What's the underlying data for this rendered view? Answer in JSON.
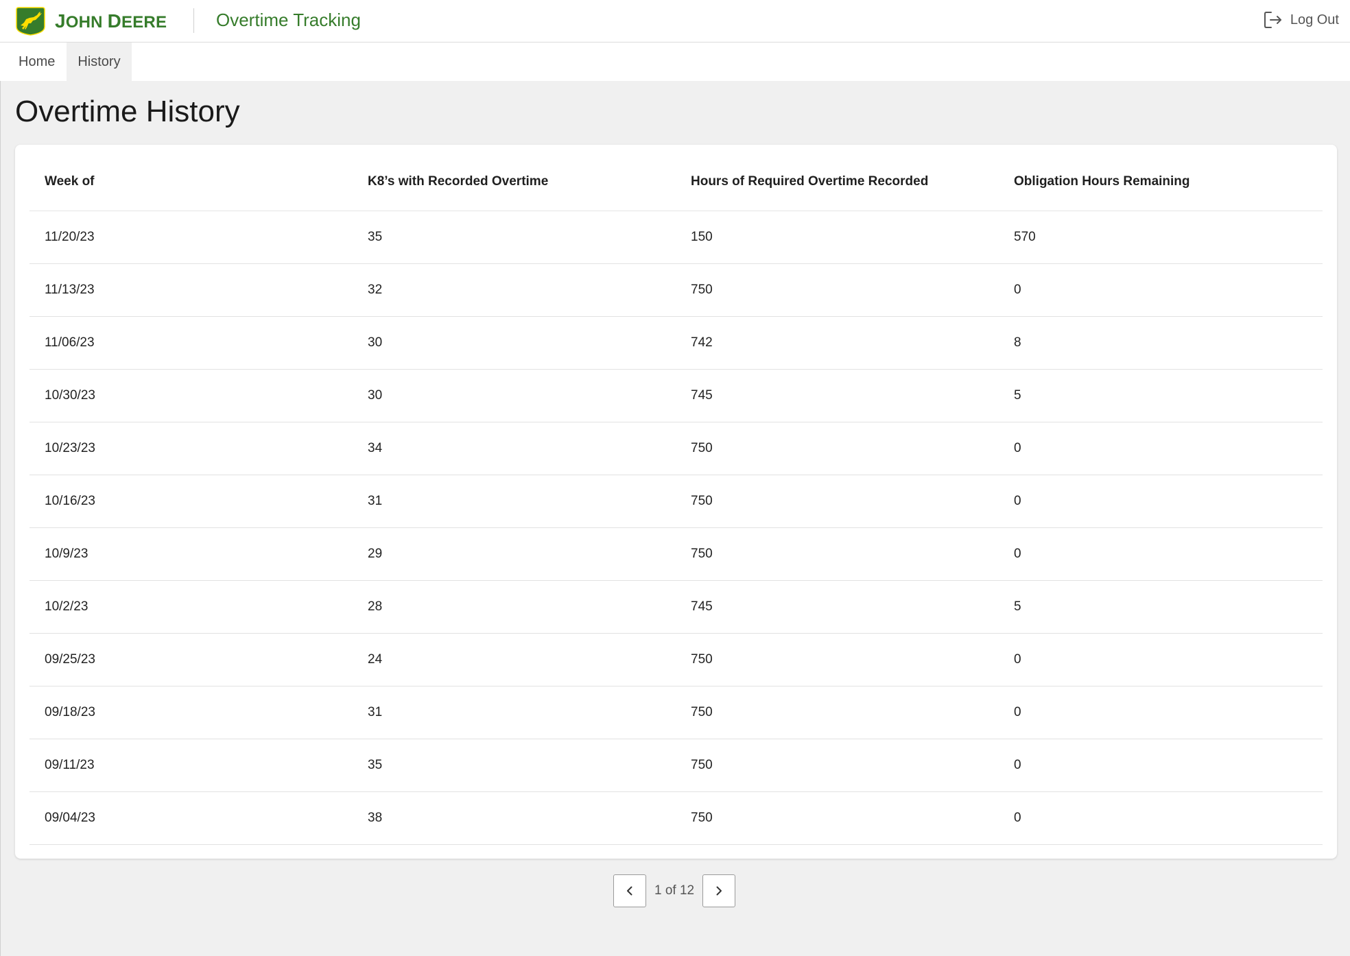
{
  "header": {
    "brand_initial_1": "J",
    "brand_rest_1": "OHN ",
    "brand_initial_2": "D",
    "brand_rest_2": "EERE",
    "app_title": "Overtime Tracking",
    "logout_label": "Log Out",
    "logo_icon": "leaping-deer-logo",
    "logout_icon": "logout-arrow-icon",
    "brand_color": "#367c2b",
    "logo_background": "#367c2b",
    "logo_deer_color": "#ffde00"
  },
  "nav": {
    "items": [
      {
        "label": "Home",
        "active": false
      },
      {
        "label": "History",
        "active": true
      }
    ]
  },
  "page": {
    "title": "Overtime History"
  },
  "table": {
    "columns": [
      "Week of",
      "K8’s with Recorded Overtime",
      "Hours of Required Overtime Recorded",
      "Obligation Hours Remaining"
    ],
    "rows": [
      [
        "11/20/23",
        "35",
        "150",
        "570"
      ],
      [
        "11/13/23",
        "32",
        "750",
        "0"
      ],
      [
        "11/06/23",
        "30",
        "742",
        "8"
      ],
      [
        "10/30/23",
        "30",
        "745",
        "5"
      ],
      [
        "10/23/23",
        "34",
        "750",
        "0"
      ],
      [
        "10/16/23",
        "31",
        "750",
        "0"
      ],
      [
        "10/9/23",
        "29",
        "750",
        "0"
      ],
      [
        "10/2/23",
        "28",
        "745",
        "5"
      ],
      [
        "09/25/23",
        "24",
        "750",
        "0"
      ],
      [
        "09/18/23",
        "31",
        "750",
        "0"
      ],
      [
        "09/11/23",
        "35",
        "750",
        "0"
      ],
      [
        "09/04/23",
        "38",
        "750",
        "0"
      ]
    ]
  },
  "pagination": {
    "current_page": 1,
    "total_pages": 12,
    "label": "1 of 12",
    "prev_icon": "chevron-left-icon",
    "next_icon": "chevron-right-icon"
  }
}
